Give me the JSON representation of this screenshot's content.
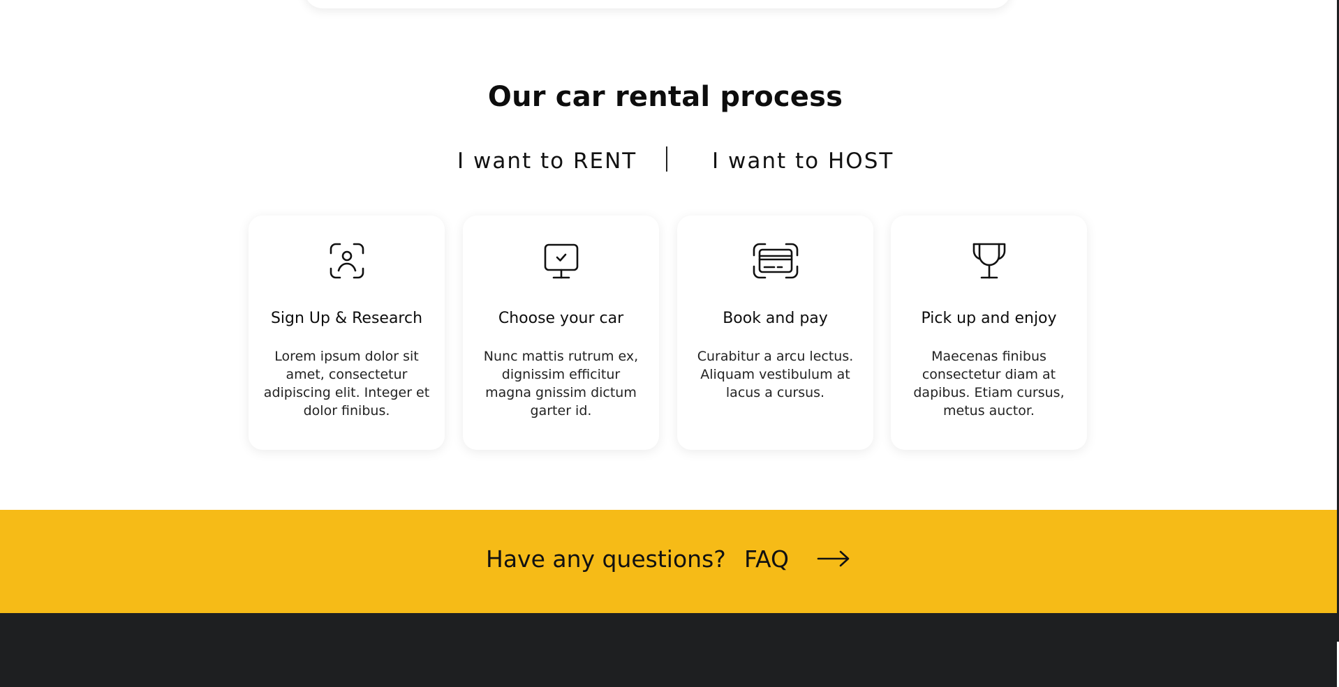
{
  "section": {
    "title": "Our car rental process"
  },
  "toggle": {
    "rent_label": "I want to RENT",
    "host_label": "I want to HOST"
  },
  "steps": [
    {
      "icon": "user-scan-icon",
      "title": "Sign Up & Research",
      "text": "Lorem ipsum dolor sit amet, consectetur adipiscing elit. Integer et dolor finibus."
    },
    {
      "icon": "monitor-check-icon",
      "title": "Choose your car",
      "text": "Nunc mattis rutrum ex, dignissim efficitur magna gnissim dictum garter id."
    },
    {
      "icon": "card-scan-icon",
      "title": "Book and pay",
      "text": "Curabitur a arcu lectus. Aliquam vestibulum at lacus a cursus."
    },
    {
      "icon": "trophy-icon",
      "title": "Pick up and enjoy",
      "text": "Maecenas finibus consectetur diam at dapibus. Etiam cursus, metus auctor."
    }
  ],
  "faq": {
    "question": "Have any questions?",
    "link_label": "FAQ",
    "arrow_icon": "arrow-right-icon"
  },
  "colors": {
    "accent": "#f6bb17",
    "footer": "#1e1f21",
    "text": "#111111"
  }
}
